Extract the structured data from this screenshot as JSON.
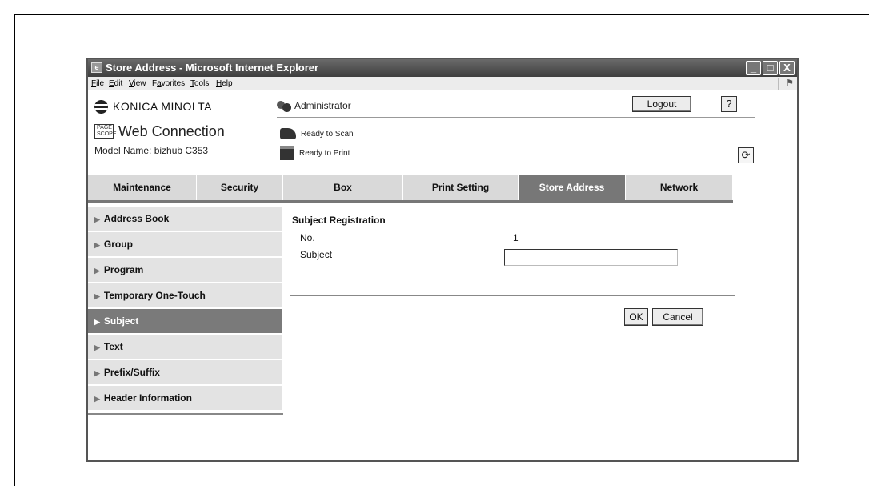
{
  "window": {
    "title": "Store Address - Microsoft Internet Explorer",
    "controls": {
      "minimize": "_",
      "maximize": "□",
      "close": "X"
    }
  },
  "menubar": {
    "items": [
      {
        "u": "F",
        "rest": "ile"
      },
      {
        "u": "E",
        "rest": "dit"
      },
      {
        "u": "V",
        "rest": "iew"
      },
      {
        "pre": "F",
        "u": "a",
        "rest": "vorites"
      },
      {
        "u": "T",
        "rest": "ools"
      },
      {
        "u": "H",
        "rest": "elp"
      }
    ]
  },
  "header": {
    "brand": "KONICA MINOLTA",
    "pagescope_icon": "PAGE SCOPE",
    "product": "Web Connection",
    "model_name": "Model Name: bizhub C353",
    "user": "Administrator",
    "logout_label": "Logout",
    "help_label": "?",
    "refresh_label": "⟳",
    "scan_status": "Ready to Scan",
    "print_status": "Ready to Print"
  },
  "tabs": [
    "Maintenance",
    "Security",
    "Box",
    "Print Setting",
    "Store Address",
    "Network"
  ],
  "active_tab": "Store Address",
  "sidebar": {
    "items": [
      "Address Book",
      "Group",
      "Program",
      "Temporary One-Touch",
      "Subject",
      "Text",
      "Prefix/Suffix",
      "Header Information"
    ],
    "active": "Subject"
  },
  "main": {
    "title": "Subject Registration",
    "no_label": "No.",
    "no_value": "1",
    "subject_label": "Subject",
    "subject_value": "",
    "ok_label": "OK",
    "cancel_label": "Cancel"
  },
  "colors": {
    "titlebar": "#4a4a4a",
    "tab_active": "#777777",
    "tab_inactive": "#d9d9d9",
    "sidebar_active": "#7a7a7a",
    "sidebar_inactive": "#e3e3e3"
  },
  "icons": {
    "title": "ie-page-icon",
    "brand": "konica-minolta-globe-icon",
    "pagescope": "pagescope-logo-icon",
    "user": "administrator-users-icon",
    "scan": "scanner-icon",
    "print": "printer-icon",
    "refresh": "refresh-icon",
    "sidebar_arrow": "triangle-right-icon",
    "xp": "windows-logo-icon"
  }
}
